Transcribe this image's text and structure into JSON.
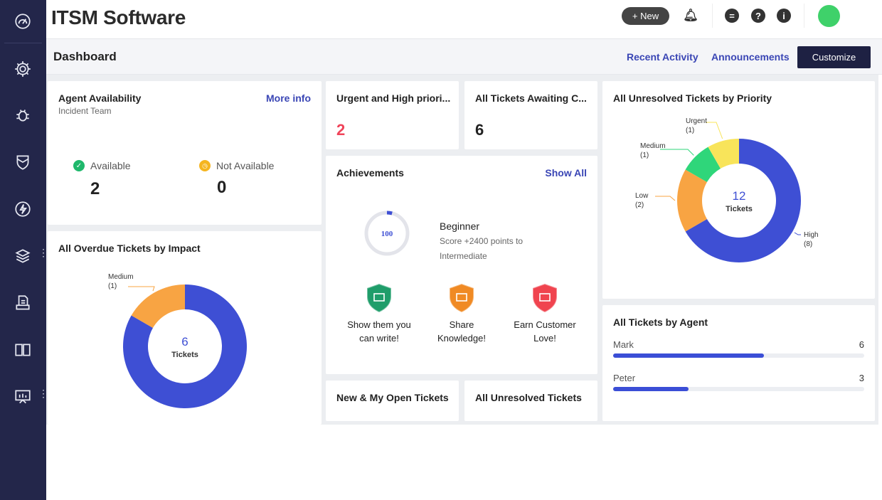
{
  "sidebar": {
    "items": [
      {
        "icon": "dashboard-gauge-icon"
      },
      {
        "icon": "gear-icon"
      },
      {
        "icon": "bug-icon"
      },
      {
        "icon": "shield-icon"
      },
      {
        "icon": "lightning-icon"
      },
      {
        "icon": "layers-icon",
        "more": true
      },
      {
        "icon": "document-tray-icon"
      },
      {
        "icon": "book-icon"
      },
      {
        "icon": "presentation-icon",
        "more": true
      }
    ]
  },
  "header": {
    "title": "ITSM Software",
    "new_label": "+ New",
    "icons": [
      "bell-icon",
      "chat-icon",
      "help-icon",
      "info-icon",
      "avatar"
    ]
  },
  "subbar": {
    "title": "Dashboard",
    "recent_activity": "Recent Activity",
    "announcements": "Announcements",
    "customize": "Customize"
  },
  "agent_availability": {
    "title": "Agent Availability",
    "subtitle": "Incident Team",
    "more_info": "More info",
    "available_label": "Available",
    "available_count": "2",
    "not_available_label": "Not Available",
    "not_available_count": "0"
  },
  "urgent": {
    "title": "Urgent and High priori...",
    "count": "2"
  },
  "awaiting": {
    "title": "All Tickets Awaiting C...",
    "count": "6"
  },
  "achievements": {
    "title": "Achievements",
    "show_all": "Show All",
    "score": "100",
    "score_progress": 0.04,
    "level": "Beginner",
    "desc": "Score +2400 points to",
    "desc2": "Intermediate",
    "badges": [
      {
        "line1": "Show them you",
        "line2": "can write!",
        "color": "#1f9d6a"
      },
      {
        "line1": "Share",
        "line2": "Knowledge!",
        "color": "#f08a24"
      },
      {
        "line1": "Earn Customer",
        "line2": "Love!",
        "color": "#f0444f"
      }
    ]
  },
  "new_open": {
    "title": "New & My Open Tickets"
  },
  "all_unresolved": {
    "title": "All Unresolved Tickets"
  },
  "chart_data": [
    {
      "type": "pie",
      "title": "All Overdue Tickets by Impact",
      "center_value": "6",
      "center_label": "Tickets",
      "slices": [
        {
          "label": "",
          "value": 5,
          "color": "#3e4fd4"
        },
        {
          "label": "Medium",
          "value": 1,
          "value_label": "(1)",
          "color": "#f8a443"
        }
      ]
    },
    {
      "type": "pie",
      "title": "All Unresolved Tickets by Priority",
      "center_value": "12",
      "center_label": "Tickets",
      "slices": [
        {
          "label": "High",
          "value": 8,
          "value_label": "(8)",
          "color": "#3e4fd4"
        },
        {
          "label": "Low",
          "value": 2,
          "value_label": "(2)",
          "color": "#f8a443"
        },
        {
          "label": "Medium",
          "value": 1,
          "value_label": "(1)",
          "color": "#2fd67a"
        },
        {
          "label": "Urgent",
          "value": 1,
          "value_label": "(1)",
          "color": "#f8e45a"
        }
      ]
    },
    {
      "type": "bar",
      "title": "All Tickets by Agent",
      "categories": [
        "Mark",
        "Peter"
      ],
      "values": [
        6,
        3
      ],
      "xlim": [
        0,
        10
      ]
    }
  ]
}
